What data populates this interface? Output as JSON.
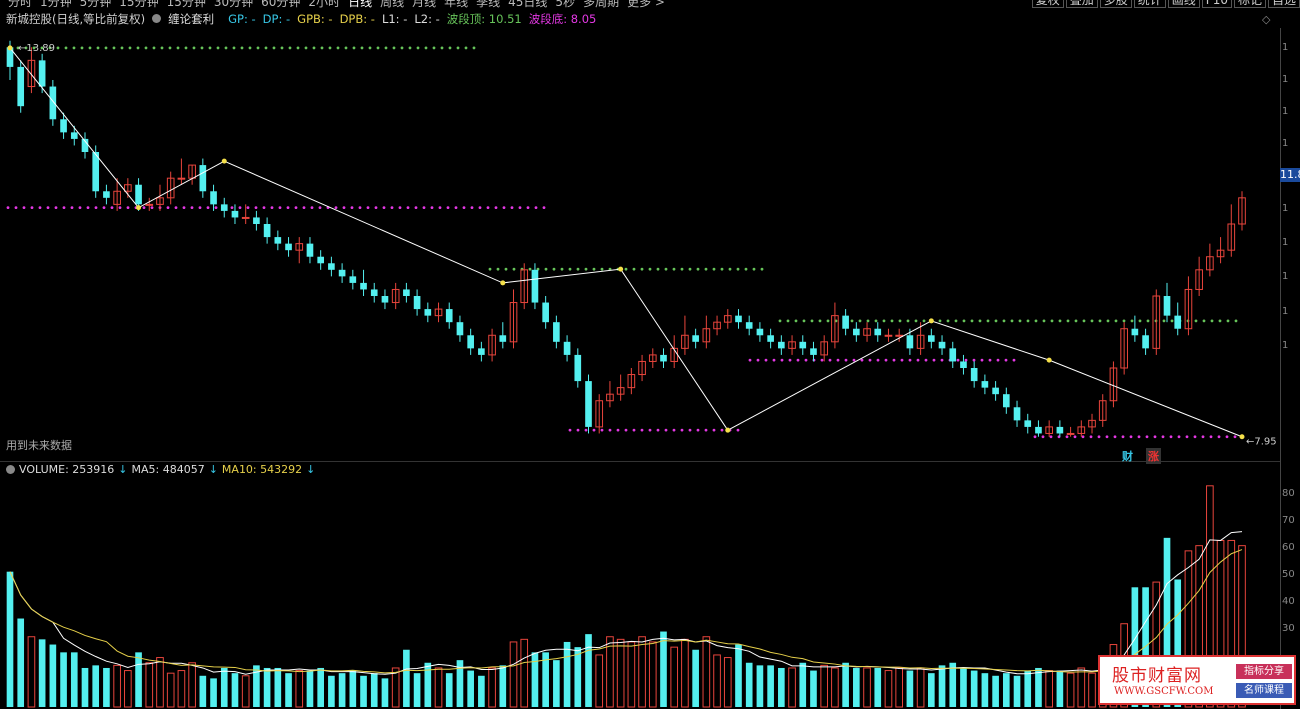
{
  "toolbar": {
    "periods": [
      "分时",
      "1分钟",
      "5分钟",
      "15分钟",
      "15分钟",
      "30分钟",
      "60分钟",
      "2小时",
      "日线",
      "周线",
      "月线",
      "年线",
      "季线",
      "45日线",
      "5秒",
      "多周期",
      "更多 >"
    ],
    "active_period": "日线",
    "right_buttons": [
      "复权",
      "叠加",
      "多股",
      "统计",
      "画线",
      "F10",
      "标记",
      "自选"
    ]
  },
  "title": {
    "stock": "新城控股(日线,等比前复权)",
    "indicator": "缠论套利",
    "gp": "GP: -",
    "dp": "DP: -",
    "gpb": "GPB: -",
    "dpb": "DPB: -",
    "l1": "L1: -",
    "l2": "L2: -",
    "top": "波段顶: 10.51",
    "bottom": "波段底: 8.05"
  },
  "future_note": "用到未来数据",
  "volume_line": {
    "volume": "VOLUME: 253916",
    "ma5": "MA5: 484057",
    "ma10": "MA10: 543292"
  },
  "labels": {
    "high": "13.89",
    "low": "7.95",
    "price_tag": "11.8",
    "cai": "财",
    "zhang": "涨"
  },
  "axis_ticks": [
    "1",
    "1",
    "1",
    "1",
    "1",
    "1",
    "1",
    "1",
    "1"
  ],
  "vol_ticks": [
    "80",
    "70",
    "60",
    "50",
    "40",
    "30"
  ],
  "watermark": {
    "name": "股市财富网",
    "url": "WWW.GSCFW.COM",
    "tag1": "指标分享",
    "tag2": "名师课程"
  },
  "colors": {
    "up": "#e8453c",
    "down": "#54f0f0",
    "zigzag": "#ffffff",
    "green_dots": "#67c45a",
    "magenta_dots": "#e338e3",
    "ma5": "#ffffff",
    "ma10": "#e6d04a"
  },
  "chart_data": {
    "type": "candlestick",
    "candles": [
      [
        13.9,
        13.6,
        14.0,
        13.4
      ],
      [
        13.6,
        13.0,
        13.7,
        12.9
      ],
      [
        13.3,
        13.7,
        13.9,
        13.2
      ],
      [
        13.7,
        13.3,
        13.8,
        13.2
      ],
      [
        13.3,
        12.8,
        13.4,
        12.7
      ],
      [
        12.8,
        12.6,
        12.9,
        12.5
      ],
      [
        12.6,
        12.5,
        12.7,
        12.4
      ],
      [
        12.5,
        12.3,
        12.6,
        12.2
      ],
      [
        12.3,
        11.7,
        12.4,
        11.6
      ],
      [
        11.7,
        11.6,
        11.8,
        11.5
      ],
      [
        11.5,
        11.7,
        11.9,
        11.4
      ],
      [
        11.7,
        11.8,
        11.9,
        11.6
      ],
      [
        11.8,
        11.5,
        11.9,
        11.4
      ],
      [
        11.5,
        11.5,
        11.6,
        11.4
      ],
      [
        11.5,
        11.6,
        11.8,
        11.4
      ],
      [
        11.6,
        11.9,
        12.0,
        11.5
      ],
      [
        11.9,
        11.9,
        12.2,
        11.8
      ],
      [
        11.9,
        12.1,
        12.1,
        11.8
      ],
      [
        12.1,
        11.7,
        12.2,
        11.6
      ],
      [
        11.7,
        11.5,
        11.8,
        11.4
      ],
      [
        11.5,
        11.4,
        11.6,
        11.3
      ],
      [
        11.4,
        11.3,
        11.5,
        11.2
      ],
      [
        11.3,
        11.3,
        11.5,
        11.2
      ],
      [
        11.3,
        11.2,
        11.4,
        11.1
      ],
      [
        11.2,
        11.0,
        11.3,
        10.9
      ],
      [
        11.0,
        10.9,
        11.1,
        10.8
      ],
      [
        10.9,
        10.8,
        11.0,
        10.7
      ],
      [
        10.8,
        10.9,
        11.0,
        10.6
      ],
      [
        10.9,
        10.7,
        11.0,
        10.6
      ],
      [
        10.7,
        10.6,
        10.8,
        10.5
      ],
      [
        10.6,
        10.5,
        10.7,
        10.4
      ],
      [
        10.5,
        10.4,
        10.6,
        10.3
      ],
      [
        10.4,
        10.3,
        10.5,
        10.2
      ],
      [
        10.3,
        10.2,
        10.5,
        10.1
      ],
      [
        10.2,
        10.1,
        10.3,
        10.0
      ],
      [
        10.1,
        10.0,
        10.2,
        9.9
      ],
      [
        10.0,
        10.2,
        10.3,
        9.9
      ],
      [
        10.2,
        10.1,
        10.3,
        10.0
      ],
      [
        10.1,
        9.9,
        10.2,
        9.8
      ],
      [
        9.9,
        9.8,
        10.0,
        9.7
      ],
      [
        9.8,
        9.9,
        10.0,
        9.7
      ],
      [
        9.9,
        9.7,
        10.0,
        9.6
      ],
      [
        9.7,
        9.5,
        9.8,
        9.4
      ],
      [
        9.5,
        9.3,
        9.6,
        9.2
      ],
      [
        9.3,
        9.2,
        9.4,
        9.1
      ],
      [
        9.2,
        9.5,
        9.6,
        9.1
      ],
      [
        9.5,
        9.4,
        9.7,
        9.3
      ],
      [
        9.4,
        10.0,
        10.2,
        9.3
      ],
      [
        10.0,
        10.5,
        10.6,
        9.9
      ],
      [
        10.5,
        10.0,
        10.6,
        9.9
      ],
      [
        10.0,
        9.7,
        10.1,
        9.6
      ],
      [
        9.7,
        9.4,
        9.8,
        9.3
      ],
      [
        9.4,
        9.2,
        9.5,
        9.1
      ],
      [
        9.2,
        8.8,
        9.3,
        8.7
      ],
      [
        8.8,
        8.1,
        8.9,
        8.0
      ],
      [
        8.1,
        8.5,
        8.6,
        8.0
      ],
      [
        8.5,
        8.6,
        8.8,
        8.4
      ],
      [
        8.6,
        8.7,
        8.9,
        8.5
      ],
      [
        8.7,
        8.9,
        9.0,
        8.6
      ],
      [
        8.9,
        9.1,
        9.2,
        8.8
      ],
      [
        9.1,
        9.2,
        9.3,
        9.0
      ],
      [
        9.2,
        9.1,
        9.3,
        9.0
      ],
      [
        9.1,
        9.3,
        9.5,
        9.0
      ],
      [
        9.3,
        9.5,
        9.8,
        9.2
      ],
      [
        9.5,
        9.4,
        9.6,
        9.3
      ],
      [
        9.4,
        9.6,
        9.8,
        9.3
      ],
      [
        9.6,
        9.7,
        9.8,
        9.5
      ],
      [
        9.7,
        9.8,
        9.9,
        9.6
      ],
      [
        9.8,
        9.7,
        9.9,
        9.6
      ],
      [
        9.7,
        9.6,
        9.8,
        9.5
      ],
      [
        9.6,
        9.5,
        9.7,
        9.4
      ],
      [
        9.5,
        9.4,
        9.6,
        9.3
      ],
      [
        9.4,
        9.3,
        9.5,
        9.2
      ],
      [
        9.3,
        9.4,
        9.5,
        9.2
      ],
      [
        9.4,
        9.3,
        9.5,
        9.2
      ],
      [
        9.3,
        9.2,
        9.4,
        9.1
      ],
      [
        9.2,
        9.4,
        9.5,
        9.1
      ],
      [
        9.4,
        9.8,
        10.0,
        9.3
      ],
      [
        9.8,
        9.6,
        9.9,
        9.5
      ],
      [
        9.6,
        9.5,
        9.7,
        9.4
      ],
      [
        9.5,
        9.6,
        9.7,
        9.4
      ],
      [
        9.6,
        9.5,
        9.7,
        9.4
      ],
      [
        9.5,
        9.5,
        9.6,
        9.4
      ],
      [
        9.5,
        9.5,
        9.6,
        9.4
      ],
      [
        9.5,
        9.3,
        9.6,
        9.2
      ],
      [
        9.3,
        9.5,
        9.7,
        9.2
      ],
      [
        9.5,
        9.4,
        9.6,
        9.3
      ],
      [
        9.4,
        9.3,
        9.5,
        9.2
      ],
      [
        9.3,
        9.1,
        9.4,
        9.0
      ],
      [
        9.1,
        9.0,
        9.2,
        8.9
      ],
      [
        9.0,
        8.8,
        9.1,
        8.7
      ],
      [
        8.8,
        8.7,
        8.9,
        8.6
      ],
      [
        8.7,
        8.6,
        8.8,
        8.5
      ],
      [
        8.6,
        8.4,
        8.7,
        8.3
      ],
      [
        8.4,
        8.2,
        8.5,
        8.1
      ],
      [
        8.2,
        8.1,
        8.3,
        8.0
      ],
      [
        8.1,
        8.0,
        8.2,
        7.95
      ],
      [
        8.0,
        8.1,
        8.2,
        7.95
      ],
      [
        8.1,
        8.0,
        8.2,
        7.95
      ],
      [
        8.0,
        8.0,
        8.1,
        7.95
      ],
      [
        8.0,
        8.1,
        8.2,
        7.95
      ],
      [
        8.1,
        8.2,
        8.3,
        8.0
      ],
      [
        8.2,
        8.5,
        8.6,
        8.1
      ],
      [
        8.5,
        9.0,
        9.1,
        8.4
      ],
      [
        9.0,
        9.6,
        9.7,
        8.9
      ],
      [
        9.6,
        9.5,
        9.8,
        9.4
      ],
      [
        9.5,
        9.3,
        9.6,
        9.2
      ],
      [
        9.3,
        10.1,
        10.2,
        9.2
      ],
      [
        10.1,
        9.8,
        10.3,
        9.7
      ],
      [
        9.8,
        9.6,
        10.0,
        9.5
      ],
      [
        9.6,
        10.2,
        10.4,
        9.5
      ],
      [
        10.2,
        10.5,
        10.7,
        10.1
      ],
      [
        10.5,
        10.7,
        10.9,
        10.4
      ],
      [
        10.7,
        10.8,
        11.0,
        10.6
      ],
      [
        10.8,
        11.2,
        11.5,
        10.7
      ],
      [
        11.2,
        11.6,
        11.7,
        11.1
      ]
    ],
    "volume": [
      52,
      34,
      27,
      26,
      24,
      21,
      21,
      15,
      16,
      15,
      16,
      14,
      21,
      17,
      19,
      13,
      14,
      17,
      12,
      11,
      15,
      13,
      12,
      16,
      15,
      15,
      13,
      14,
      14,
      15,
      12,
      13,
      14,
      12,
      13,
      11,
      15,
      22,
      13,
      17,
      15,
      13,
      18,
      14,
      12,
      15,
      16,
      25,
      26,
      21,
      21,
      18,
      25,
      23,
      28,
      20,
      27,
      26,
      25,
      27,
      25,
      29,
      23,
      26,
      22,
      27,
      20,
      19,
      24,
      17,
      16,
      16,
      15,
      15,
      17,
      14,
      16,
      15,
      17,
      15,
      15,
      15,
      14,
      15,
      14,
      15,
      13,
      16,
      17,
      15,
      14,
      13,
      12,
      13,
      12,
      14,
      15,
      14,
      14,
      13,
      15,
      13,
      16,
      24,
      32,
      46,
      46,
      48,
      65,
      49,
      60,
      62,
      85,
      64,
      64,
      62,
      25
    ],
    "zigzag": [
      [
        0,
        13.89
      ],
      [
        8,
        11.45
      ],
      [
        13,
        12.16
      ],
      [
        30,
        10.3
      ],
      [
        37,
        10.51
      ],
      [
        44,
        8.05
      ],
      [
        56,
        9.72
      ],
      [
        63,
        9.12
      ],
      [
        75,
        7.95
      ]
    ],
    "green_lines": [
      10.51,
      8.05
    ],
    "title": "新城控股(日线,等比前复权)"
  }
}
